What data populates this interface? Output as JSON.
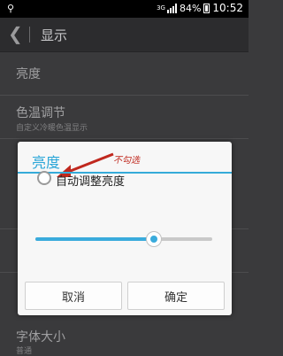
{
  "status_bar": {
    "usb_icon": "usb-icon",
    "network": "3G",
    "battery": "84%",
    "time": "10:52",
    "signal_level": 1.0,
    "battery_level": 0.84
  },
  "app_bar": {
    "back_icon": "chevron-left-icon",
    "title": "显示"
  },
  "settings": {
    "items": [
      {
        "title": "亮度",
        "subtitle": ""
      },
      {
        "title": "色温调节",
        "subtitle": "自定义冷暖色温显示"
      },
      {
        "title": "字体大小",
        "subtitle": "普通"
      }
    ]
  },
  "dialog": {
    "title": "亮度",
    "auto_brightness_label": "自动调整亮度",
    "auto_brightness_checked": false,
    "annotation": "不勾选",
    "brightness_level": 0.67,
    "cancel_label": "取消",
    "confirm_label": "确定",
    "accent_color": "#35abd9",
    "annotation_color": "#c0281e"
  }
}
